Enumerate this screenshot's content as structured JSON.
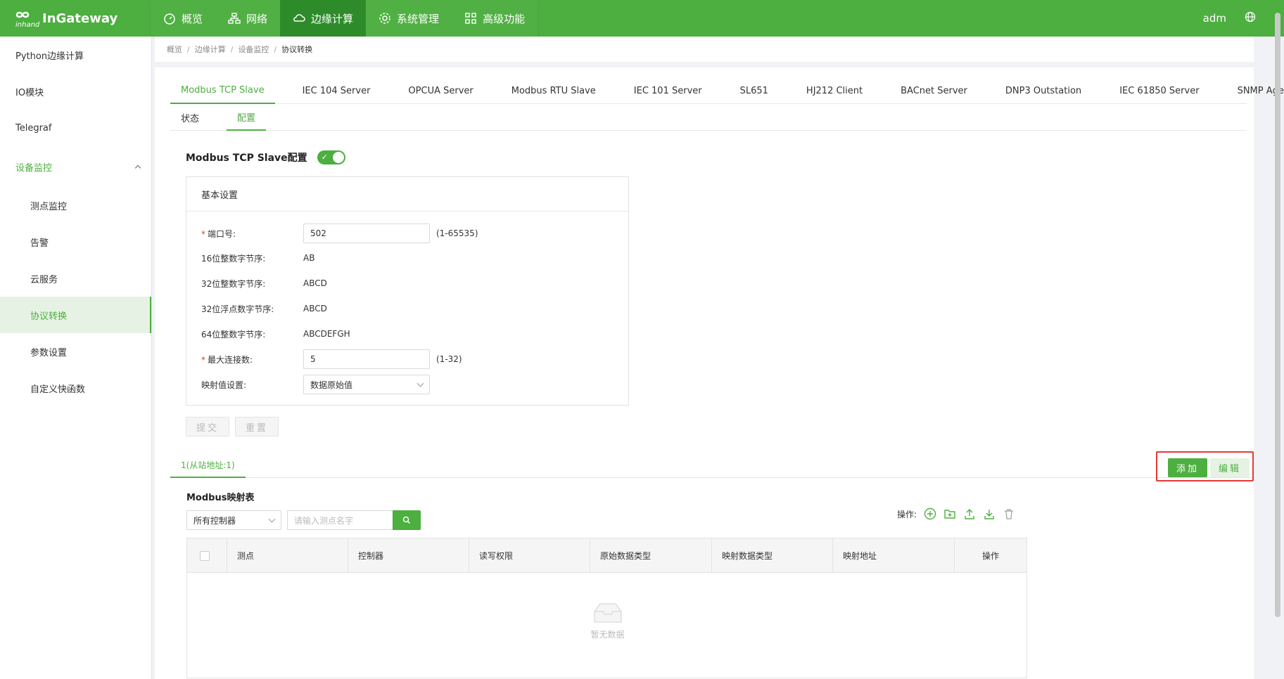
{
  "app": {
    "logo_text": "InGateway",
    "logo_sub": "inhand",
    "user": "adm"
  },
  "nav": [
    {
      "label": "概览",
      "icon": "dashboard-icon"
    },
    {
      "label": "网络",
      "icon": "network-icon"
    },
    {
      "label": "边缘计算",
      "icon": "cloud-icon"
    },
    {
      "label": "系统管理",
      "icon": "gear-icon"
    },
    {
      "label": "高级功能",
      "icon": "grid-icon"
    }
  ],
  "sidebar": {
    "items": [
      {
        "label": "Python边缘计算"
      },
      {
        "label": "IO模块"
      },
      {
        "label": "Telegraf"
      },
      {
        "label": "设备监控"
      },
      {
        "label": "测点监控"
      },
      {
        "label": "告警"
      },
      {
        "label": "云服务"
      },
      {
        "label": "协议转换"
      },
      {
        "label": "参数设置"
      },
      {
        "label": "自定义快函数"
      }
    ]
  },
  "breadcrumb": [
    "概览",
    "边缘计算",
    "设备监控",
    "协议转换"
  ],
  "proto_tabs": [
    "Modbus TCP Slave",
    "IEC 104 Server",
    "OPCUA Server",
    "Modbus RTU Slave",
    "IEC 101 Server",
    "SL651",
    "HJ212 Client",
    "BACnet Server",
    "DNP3 Outstation",
    "IEC 61850 Server",
    "SNMP Agent"
  ],
  "sub_tabs": [
    "状态",
    "配置"
  ],
  "config": {
    "title": "Modbus TCP Slave配置",
    "switch_on": true,
    "basic_title": "基本设置",
    "port_label": "端口号:",
    "port_value": "502",
    "port_hint": "(1-65535)",
    "int16_label": "16位整数字节序:",
    "int16_value": "AB",
    "int32_label": "32位整数字节序:",
    "int32_value": "ABCD",
    "float32_label": "32位浮点数字节序:",
    "float32_value": "ABCD",
    "int64_label": "64位整数字节序:",
    "int64_value": "ABCDEFGH",
    "maxconn_label": "最大连接数:",
    "maxconn_value": "5",
    "maxconn_hint": "(1-32)",
    "mapping_label": "映射值设置:",
    "mapping_value": "数据原始值",
    "submit_label": "提交",
    "reset_label": "重置"
  },
  "slave_tab": "1(从站地址:1)",
  "actions": {
    "add_label": "添加",
    "edit_label": "编辑"
  },
  "mapping": {
    "title": "Modbus映射表",
    "controller_select": "所有控制器",
    "search_placeholder": "请输入测点名字",
    "ops_label": "操作:",
    "columns": [
      "测点",
      "控制器",
      "读写权限",
      "原始数据类型",
      "映射数据类型",
      "映射地址",
      "操作"
    ],
    "empty_text": "暂无数据"
  },
  "colors": {
    "brand": "#4caf3f",
    "highlight": "#e53935"
  }
}
